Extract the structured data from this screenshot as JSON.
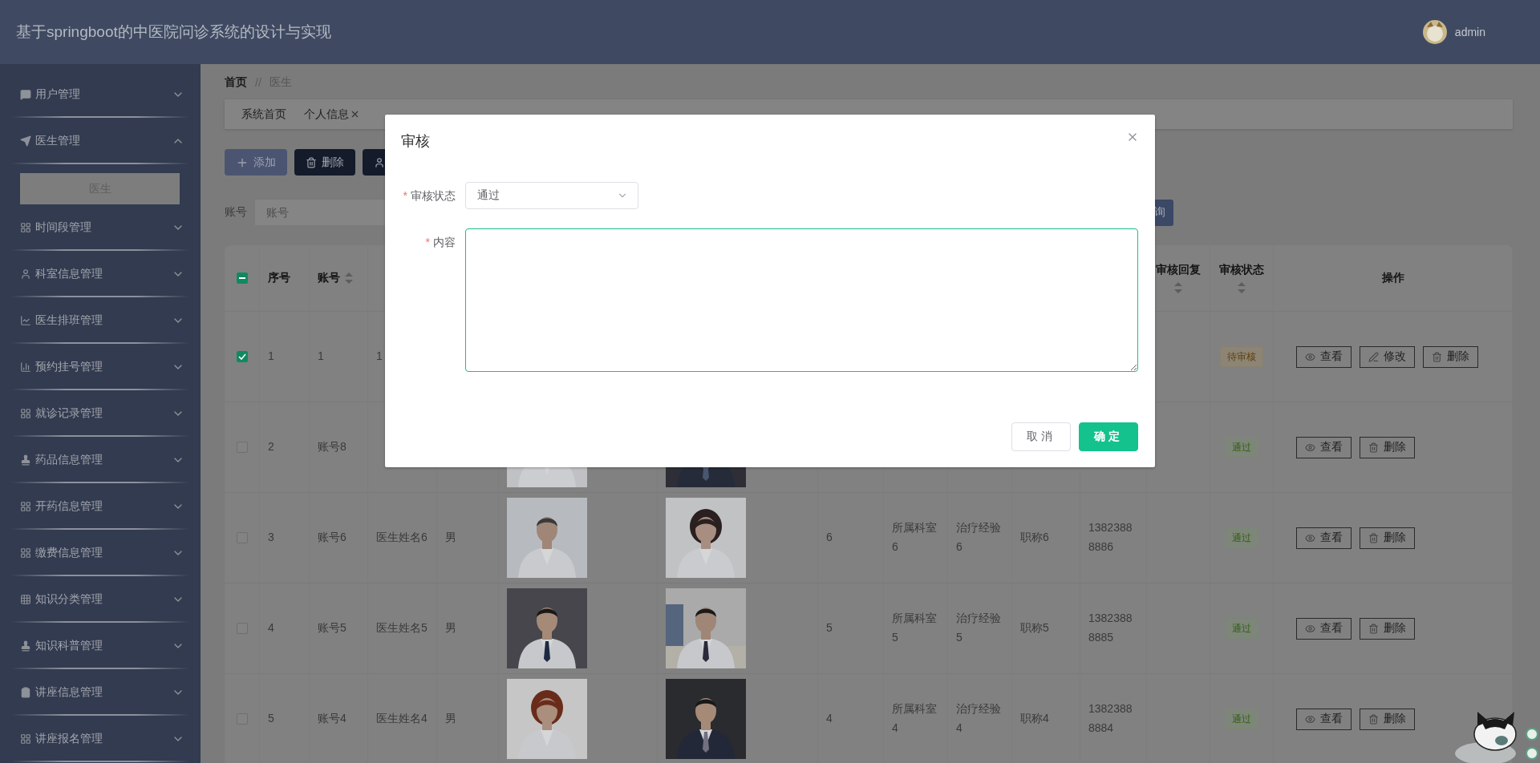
{
  "header": {
    "title": "基于springboot的中医院问诊系统的设计与实现",
    "user": {
      "name": "admin"
    }
  },
  "sidebar": {
    "items": [
      {
        "label": "用户管理",
        "expanded": false
      },
      {
        "label": "医生管理",
        "expanded": true,
        "children": [
          {
            "label": "医生",
            "selected": true
          }
        ]
      },
      {
        "label": "时间段管理",
        "expanded": false
      },
      {
        "label": "科室信息管理",
        "expanded": false
      },
      {
        "label": "医生排班管理",
        "expanded": false
      },
      {
        "label": "预约挂号管理",
        "expanded": false
      },
      {
        "label": "就诊记录管理",
        "expanded": false
      },
      {
        "label": "药品信息管理",
        "expanded": false
      },
      {
        "label": "开药信息管理",
        "expanded": false
      },
      {
        "label": "缴费信息管理",
        "expanded": false
      },
      {
        "label": "知识分类管理",
        "expanded": false
      },
      {
        "label": "知识科普管理",
        "expanded": false
      },
      {
        "label": "讲座信息管理",
        "expanded": false
      },
      {
        "label": "讲座报名管理",
        "expanded": false
      }
    ]
  },
  "breadcrumb": {
    "separator": "//",
    "items": [
      {
        "label": "首页",
        "current": false
      },
      {
        "label": "医生",
        "current": true
      }
    ]
  },
  "tabs": [
    {
      "label": "系统首页",
      "closable": false
    },
    {
      "label": "个人信息",
      "closable": true
    }
  ],
  "toolbar": [
    {
      "label": "添加",
      "kind": "add"
    },
    {
      "label": "删除",
      "kind": "delete"
    },
    {
      "kind": "user"
    }
  ],
  "search": {
    "label": "账号",
    "placeholder": "账号",
    "button": "询"
  },
  "table": {
    "select_all": {
      "indeterminate": true
    },
    "columns": [
      {
        "label": "序号",
        "sortable": false
      },
      {
        "label": "账号",
        "sortable": true
      },
      {
        "label": "审核回复",
        "sortable": true
      },
      {
        "label": "审核状态",
        "sortable": true
      },
      {
        "label": "操作",
        "sortable": false
      }
    ],
    "rows": [
      {
        "selected": true,
        "index": "1",
        "account": "1",
        "name": "1",
        "status": {
          "label": "待审核",
          "kind": "pending"
        },
        "actions": [
          {
            "label": "查看",
            "kind": "view"
          },
          {
            "label": "修改",
            "kind": "edit"
          },
          {
            "label": "删除",
            "kind": "delete"
          }
        ]
      },
      {
        "selected": false,
        "index": "2",
        "account": "账号8",
        "photos": [
          {
            "kind": "picture"
          },
          {
            "kind": "picture"
          }
        ],
        "status": {
          "label": "通过",
          "kind": "approved"
        },
        "actions": [
          {
            "label": "查看",
            "kind": "view"
          },
          {
            "label": "删除",
            "kind": "delete"
          }
        ]
      },
      {
        "selected": false,
        "index": "3",
        "account": "账号6",
        "name": "医生姓名6",
        "gender": "男",
        "photos": [
          {
            "kind": "picture"
          },
          {
            "kind": "picture"
          }
        ],
        "column_8": "6",
        "department": "所属科室6",
        "experience": "治疗经验6",
        "title": "职称6",
        "phone": "13823888886",
        "status": {
          "label": "通过",
          "kind": "approved"
        },
        "actions": [
          {
            "label": "查看",
            "kind": "view"
          },
          {
            "label": "删除",
            "kind": "delete"
          }
        ]
      },
      {
        "selected": false,
        "index": "4",
        "account": "账号5",
        "name": "医生姓名5",
        "gender": "男",
        "photos": [
          {
            "kind": "picture"
          },
          {
            "kind": "picture"
          }
        ],
        "column_8": "5",
        "department": "所属科室5",
        "experience": "治疗经验5",
        "title": "职称5",
        "phone": "13823888885",
        "status": {
          "label": "通过",
          "kind": "approved"
        },
        "actions": [
          {
            "label": "查看",
            "kind": "view"
          },
          {
            "label": "删除",
            "kind": "delete"
          }
        ]
      },
      {
        "selected": false,
        "index": "5",
        "account": "账号4",
        "name": "医生姓名4",
        "gender": "男",
        "photos": [
          {
            "kind": "picture"
          },
          {
            "kind": "picture"
          }
        ],
        "column_8": "4",
        "department": "所属科室4",
        "experience": "治疗经验4",
        "title": "职称4",
        "phone": "13823888884",
        "status": {
          "label": "通过",
          "kind": "approved"
        },
        "actions": [
          {
            "label": "查看",
            "kind": "view"
          },
          {
            "label": "删除",
            "kind": "delete"
          }
        ]
      }
    ]
  },
  "dialog": {
    "title": "审核",
    "fields": [
      {
        "label": "审核状态",
        "required_mark": "*",
        "kind": "select",
        "value": "通过"
      },
      {
        "label": "内容",
        "required_mark": "*",
        "kind": "textarea",
        "focused": true
      }
    ],
    "buttons": [
      {
        "label": "取消",
        "kind": "default"
      },
      {
        "label": "确定",
        "kind": "primary"
      }
    ]
  }
}
